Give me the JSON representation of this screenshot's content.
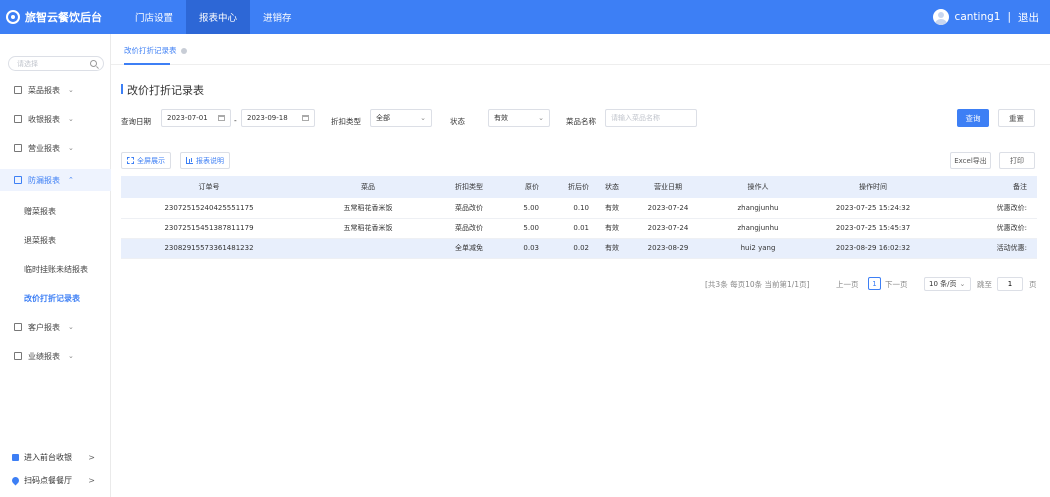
{
  "app": {
    "title": "旅智云餐饮后台"
  },
  "top_nav": [
    {
      "label": "门店设置",
      "active": false
    },
    {
      "label": "报表中心",
      "active": true
    },
    {
      "label": "进销存",
      "active": false
    }
  ],
  "user": {
    "name": "canting1",
    "separator": "|",
    "logout": "退出"
  },
  "sidebar": {
    "search_placeholder": "请选择",
    "menus": [
      {
        "label": "菜品报表",
        "icon": "dish-report-icon",
        "open": false
      },
      {
        "label": "收银报表",
        "icon": "cashier-report-icon",
        "open": false
      },
      {
        "label": "营业报表",
        "icon": "business-report-icon",
        "open": false
      },
      {
        "label": "防漏报表",
        "icon": "leak-report-icon",
        "open": true
      },
      {
        "label": "客户报表",
        "icon": "customer-report-icon",
        "open": false
      },
      {
        "label": "业绩报表",
        "icon": "performance-report-icon",
        "open": false
      }
    ],
    "sub_items": [
      {
        "label": "赠菜报表",
        "active": false
      },
      {
        "label": "退菜报表",
        "active": false
      },
      {
        "label": "临时挂账未结报表",
        "active": false
      },
      {
        "label": "改价打折记录表",
        "active": true
      }
    ],
    "bottom": [
      {
        "label": "进入前台收银",
        "icon": "cash-register-icon"
      },
      {
        "label": "扫码点餐餐厅",
        "icon": "location-pin-icon"
      }
    ]
  },
  "tab": {
    "label": "改价打折记录表"
  },
  "page": {
    "title": "改价打折记录表"
  },
  "filters": {
    "date_label": "查询日期",
    "date_from": "2023-07-01",
    "date_sep": "-",
    "date_to": "2023-09-18",
    "discount_type_label": "折扣类型",
    "discount_type_value": "全部",
    "status_label": "状态",
    "status_value": "有效",
    "dish_label": "菜品名称",
    "dish_placeholder": "请输入菜品名称",
    "query_button": "查询",
    "reset_button": "重置"
  },
  "toolbar": {
    "fullscreen": "全屏展示",
    "report_info": "报表说明",
    "excel_export": "Excel导出",
    "print": "打印"
  },
  "table": {
    "columns": [
      "订单号",
      "菜品",
      "折扣类型",
      "原价",
      "折后价",
      "状态",
      "营业日期",
      "操作人",
      "操作时间",
      "备注"
    ],
    "rows": [
      [
        "23072515240425551175",
        "五常稻花香米饭",
        "菜品改价",
        "5.00",
        "0.10",
        "有效",
        "2023-07-24",
        "zhangjunhu",
        "2023-07-25 15:24:32",
        "优惠改价:"
      ],
      [
        "23072515451387811179",
        "五常稻花香米饭",
        "菜品改价",
        "5.00",
        "0.01",
        "有效",
        "2023-07-24",
        "zhangjunhu",
        "2023-07-25 15:45:37",
        "优惠改价:"
      ],
      [
        "23082915573361481232",
        "",
        "全单减免",
        "0.03",
        "0.02",
        "有效",
        "2023-08-29",
        "hui2 yang",
        "2023-08-29 16:02:32",
        "活动优惠:"
      ]
    ]
  },
  "pagination": {
    "summary": "[共3条 每页10条 当前第1/1页]",
    "prev": "上一页",
    "current_page": "1",
    "next": "下一页",
    "page_size": "10 条/页",
    "goto_label": "跳至",
    "goto_value": "1",
    "page_suffix": "页"
  }
}
